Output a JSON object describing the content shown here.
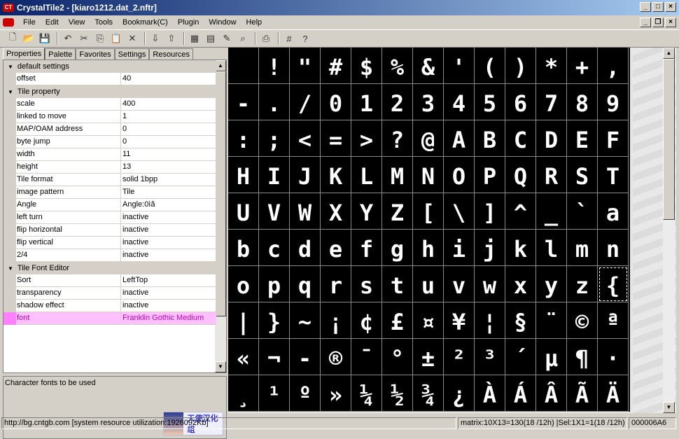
{
  "window": {
    "title": "CrystalTile2 - [kiaro1212.dat_2.nftr]",
    "app_icon": "ct-logo-icon"
  },
  "menu": [
    "File",
    "Edit",
    "View",
    "Tools",
    "Bookmark(C)",
    "Plugin",
    "Window",
    "Help"
  ],
  "toolbar": [
    "new-file-icon",
    "open-folder-icon",
    "save-icon",
    "undo-icon",
    "cut-icon",
    "copy-icon",
    "paste-icon",
    "delete-icon",
    "import-icon",
    "export-icon",
    "tile-view-icon",
    "palette-icon",
    "edit-icon",
    "search-icon",
    "print-icon",
    "grid-icon",
    "help-icon"
  ],
  "tabs": [
    "Properties",
    "Palette",
    "Favorites",
    "Settings",
    "Resources"
  ],
  "property_groups": [
    {
      "name": "default settings",
      "rows": [
        {
          "name": "offset",
          "value": "40"
        }
      ]
    },
    {
      "name": "Tile property",
      "rows": [
        {
          "name": "scale",
          "value": "400"
        },
        {
          "name": "linked to move",
          "value": "1"
        },
        {
          "name": "MAP/OAM address",
          "value": "0"
        },
        {
          "name": "byte jump",
          "value": "0"
        },
        {
          "name": "width",
          "value": "11"
        },
        {
          "name": "height",
          "value": "13"
        },
        {
          "name": "Tile format",
          "value": "solid 1bpp"
        },
        {
          "name": "image pattern",
          "value": "Tile"
        },
        {
          "name": "Angle",
          "value": "Angle:0ìă"
        },
        {
          "name": "left turn",
          "value": "inactive"
        },
        {
          "name": "flip horizontal",
          "value": "inactive"
        },
        {
          "name": "flip vertical",
          "value": "inactive"
        },
        {
          "name": "2/4",
          "value": "inactive"
        }
      ]
    },
    {
      "name": "Tile Font Editor",
      "rows": [
        {
          "name": "Sort",
          "value": "LeftTop"
        },
        {
          "name": "transparency",
          "value": "inactive"
        },
        {
          "name": "shadow effect",
          "value": "inactive"
        },
        {
          "name": "font",
          "value": "Franklin Gothic Medium",
          "selected": true
        }
      ]
    }
  ],
  "description": "Character fonts to be used",
  "logo_text": "天使汉化组",
  "tiles": [
    "",
    "!",
    "\"",
    "#",
    "$",
    "%",
    "&",
    "'",
    "(",
    ")",
    "*",
    "+",
    ",",
    "-",
    ".",
    "/",
    "0",
    "1",
    "2",
    "3",
    "4",
    "5",
    "6",
    "7",
    "8",
    "9",
    ":",
    ";",
    "<",
    "=",
    ">",
    "?",
    "@",
    "A",
    "B",
    "C",
    "D",
    "E",
    "F",
    "H",
    "I",
    "J",
    "K",
    "L",
    "M",
    "N",
    "O",
    "P",
    "Q",
    "R",
    "S",
    "T",
    "U",
    "V",
    "W",
    "X",
    "Y",
    "Z",
    "[",
    "\\",
    "]",
    "^",
    "_",
    "`",
    "a",
    "b",
    "c",
    "d",
    "e",
    "f",
    "g",
    "h",
    "i",
    "j",
    "k",
    "l",
    "m",
    "n",
    "o",
    "p",
    "q",
    "r",
    "s",
    "t",
    "u",
    "v",
    "w",
    "x",
    "y",
    "z",
    "{",
    "|",
    "}",
    "~",
    "¡",
    "¢",
    "£",
    "¤",
    "¥",
    "¦",
    "§",
    "¨",
    "©",
    "ª",
    "«",
    "¬",
    "-",
    "®",
    "¯",
    "°",
    "±",
    "²",
    "³",
    "´",
    "µ",
    "¶",
    "·",
    "¸",
    "¹",
    "º",
    "»",
    "¼",
    "½",
    "¾",
    "¿",
    "À",
    "Á",
    "Â",
    "Ã",
    "Ä"
  ],
  "selected_tile": 90,
  "status": {
    "url": "http://bg.cntgb.com [system resource utilization:1926092Kb]",
    "matrix": "matrix:10X13=130(18 /12h) |Sel:1X1=1(18 /12h)",
    "address": "000006A6"
  }
}
